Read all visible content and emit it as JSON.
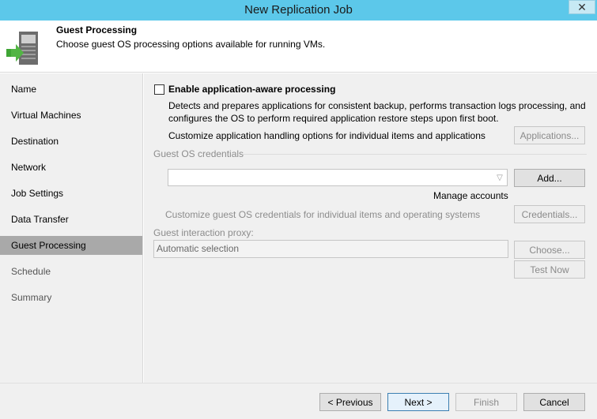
{
  "window": {
    "title": "New Replication Job",
    "close_label": "✕"
  },
  "header": {
    "title": "Guest Processing",
    "subtitle": "Choose guest OS processing options available for running VMs."
  },
  "nav": {
    "items": [
      {
        "label": "Name"
      },
      {
        "label": "Virtual Machines"
      },
      {
        "label": "Destination"
      },
      {
        "label": "Network"
      },
      {
        "label": "Job Settings"
      },
      {
        "label": "Data Transfer"
      },
      {
        "label": "Guest Processing"
      },
      {
        "label": "Schedule"
      },
      {
        "label": "Summary"
      }
    ],
    "active": "Guest Processing"
  },
  "content": {
    "enable_app_aware": {
      "label": "Enable application-aware processing",
      "checked": false
    },
    "description_line1": "Detects and prepares applications for consistent backup, performs transaction logs processing, and",
    "description_line2": "configures the OS to perform required application restore steps upon first boot.",
    "customize_apps_text": "Customize application handling options for individual items and applications",
    "applications_button": "Applications...",
    "credentials_group_label": "Guest OS credentials",
    "credentials_value": "",
    "add_button": "Add...",
    "manage_accounts_link": "Manage accounts",
    "customize_creds_text": "Customize guest OS credentials for individual items and operating systems",
    "credentials_button": "Credentials...",
    "proxy_label": "Guest interaction proxy:",
    "proxy_value": "Automatic selection",
    "choose_button": "Choose...",
    "test_now_button": "Test Now"
  },
  "footer": {
    "previous": "< Previous",
    "next": "Next >",
    "finish": "Finish",
    "cancel": "Cancel"
  },
  "colors": {
    "titlebar": "#5cc8ea",
    "nav_active": "#a9a9a9",
    "panel_bg": "#f0f0f0",
    "icon_green": "#3fa535"
  }
}
